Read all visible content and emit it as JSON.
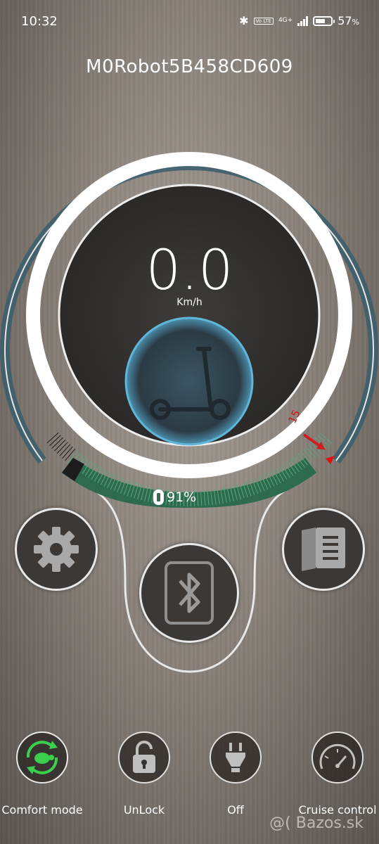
{
  "status_bar": {
    "time": "10:32",
    "network": "4G+",
    "volte": "Vo LTE",
    "battery_percent": "57"
  },
  "device_name": "M0Robot5B458CD609",
  "gauge": {
    "speed": "0.0",
    "unit": "Km/h",
    "speed_limit_marker": "15",
    "battery_percent": "91%",
    "battery_fraction": 0.91
  },
  "controls": {
    "settings": "settings",
    "bluetooth": "bluetooth",
    "manual": "manual"
  },
  "bottom_bar": [
    {
      "label": "Comfort mode",
      "icon": "turtle-mode-icon",
      "color": "#3ccf4e"
    },
    {
      "label": "UnLock",
      "icon": "unlock-icon"
    },
    {
      "label": "Off",
      "icon": "headlight-icon"
    },
    {
      "label": "Cruise control",
      "icon": "cruise-control-icon"
    }
  ],
  "watermark": "@( Bazos.sk"
}
